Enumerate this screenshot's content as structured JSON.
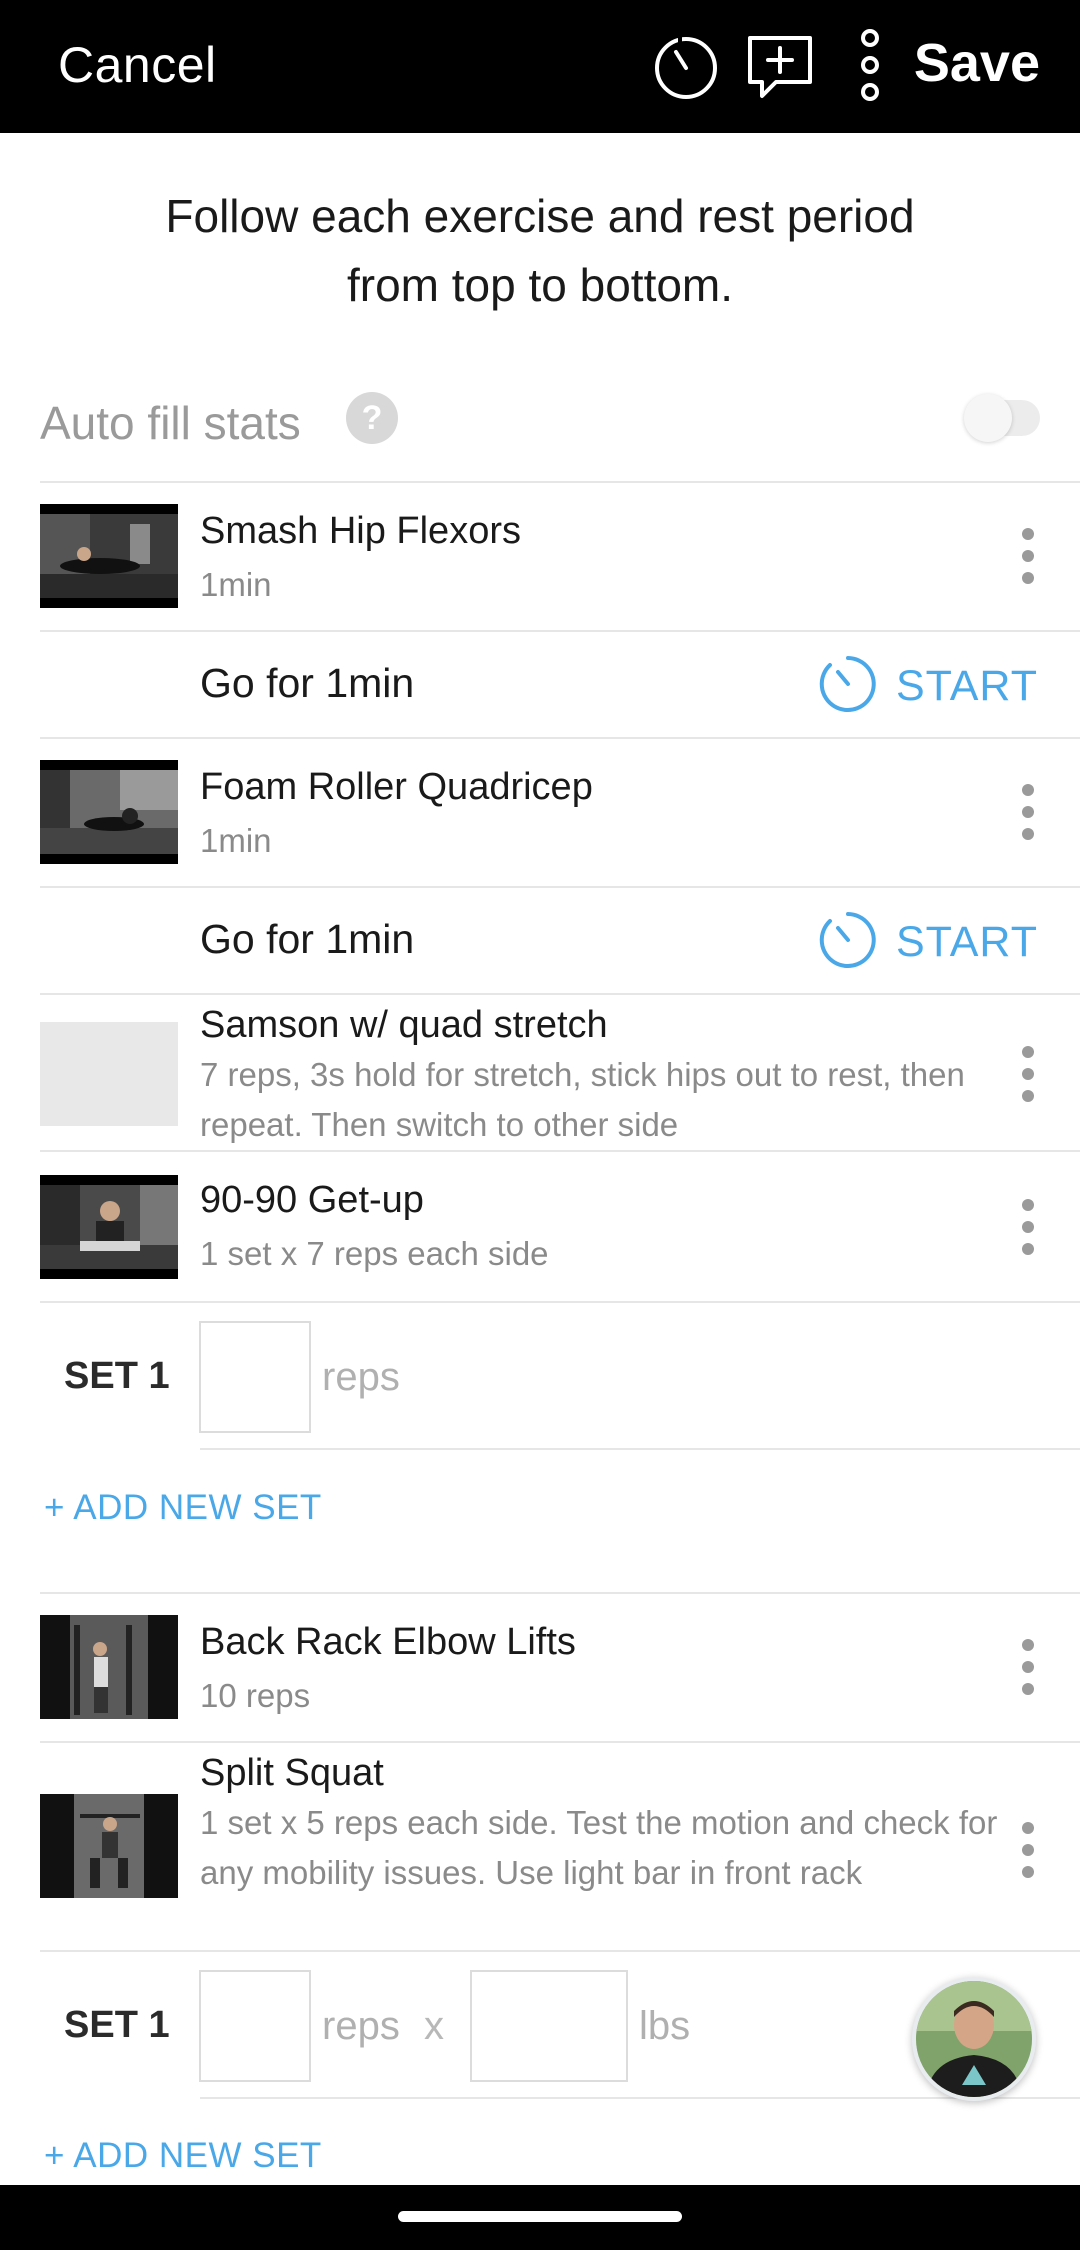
{
  "header": {
    "cancel_label": "Cancel",
    "save_label": "Save",
    "icons": [
      "timer-icon",
      "add-note-icon",
      "more-vertical-icon"
    ]
  },
  "intro": {
    "line1": "Follow each exercise and rest period",
    "line2": "from top to bottom."
  },
  "auto_fill": {
    "label": "Auto fill stats",
    "help": "?",
    "enabled": false
  },
  "exercises": [
    {
      "title": "Smash Hip Flexors",
      "subtitle": "1min"
    },
    {
      "title": "Foam Roller Quadricep",
      "subtitle": "1min"
    },
    {
      "title": "Samson w/ quad stretch",
      "subtitle": "7 reps, 3s hold for stretch, stick hips out to rest, then repeat.  Then switch to other side"
    },
    {
      "title": "90-90 Get-up",
      "subtitle": "1 set x 7 reps each side"
    },
    {
      "title": "Back Rack Elbow Lifts",
      "subtitle": "10 reps"
    },
    {
      "title": "Split Squat",
      "subtitle": "1 set x 5 reps each side. Test the motion and check for any mobility issues. Use light bar in front rack"
    }
  ],
  "timers": [
    {
      "label": "Go for 1min",
      "action": "START"
    },
    {
      "label": "Go for 1min",
      "action": "START"
    }
  ],
  "sets": [
    {
      "label": "SET 1",
      "reps_unit": "reps"
    },
    {
      "label": "SET 1",
      "reps_unit": "reps",
      "x": "x",
      "weight_unit": "lbs"
    }
  ],
  "add_new_set": "+ ADD NEW SET",
  "colors": {
    "accent": "#4aa8e8",
    "header_bg": "#000000",
    "muted_text": "#8a8a8a"
  }
}
